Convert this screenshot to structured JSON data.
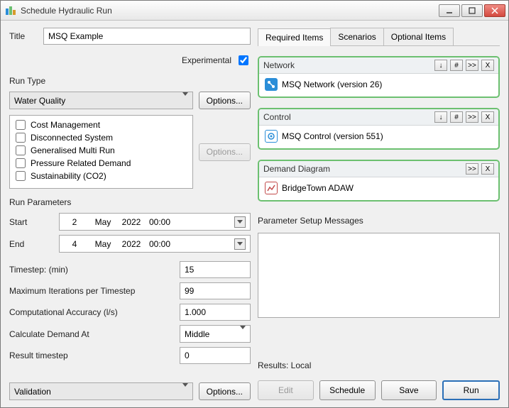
{
  "window": {
    "title": "Schedule Hydraulic Run"
  },
  "title_field": {
    "label": "Title",
    "value": "MSQ Example"
  },
  "experimental": {
    "label": "Experimental",
    "checked": true
  },
  "run_type": {
    "header": "Run Type",
    "selected": "Water Quality",
    "options_btn": "Options...",
    "options_btn_disabled": "Options...",
    "checklist": [
      {
        "label": "Cost Management",
        "checked": false
      },
      {
        "label": "Disconnected System",
        "checked": false
      },
      {
        "label": "Generalised Multi Run",
        "checked": false
      },
      {
        "label": "Pressure Related Demand",
        "checked": false
      },
      {
        "label": "Sustainability (CO2)",
        "checked": false
      }
    ]
  },
  "run_params": {
    "header": "Run Parameters",
    "start_label": "Start",
    "start": {
      "day": "2",
      "month": "May",
      "year": "2022",
      "time": "00:00"
    },
    "end_label": "End",
    "end": {
      "day": "4",
      "month": "May",
      "year": "2022",
      "time": "00:00"
    },
    "timestep_label": "Timestep: (min)",
    "timestep": "15",
    "maxiter_label": "Maximum Iterations per Timestep",
    "maxiter": "99",
    "accuracy_label": "Computational Accuracy (l/s)",
    "accuracy": "1.000",
    "calcdemand_label": "Calculate Demand At",
    "calcdemand": "Middle",
    "result_ts_label": "Result timestep",
    "result_ts": "0"
  },
  "validation": {
    "selected": "Validation",
    "options_btn": "Options..."
  },
  "tabs": {
    "items": [
      "Required Items",
      "Scenarios",
      "Optional Items"
    ],
    "active": 0
  },
  "required": {
    "network": {
      "header": "Network",
      "item": "MSQ Network (version 26)",
      "btns": [
        "↓",
        "#",
        ">>",
        "X"
      ]
    },
    "control": {
      "header": "Control",
      "item": "MSQ Control (version 551)",
      "btns": [
        "↓",
        "#",
        ">>",
        "X"
      ]
    },
    "demand": {
      "header": "Demand Diagram",
      "item": "BridgeTown ADAW",
      "btns": [
        ">>",
        "X"
      ]
    }
  },
  "messages": {
    "header": "Parameter Setup Messages"
  },
  "results": {
    "label": "Results: Local"
  },
  "actions": {
    "edit": "Edit",
    "schedule": "Schedule",
    "save": "Save",
    "run": "Run"
  }
}
